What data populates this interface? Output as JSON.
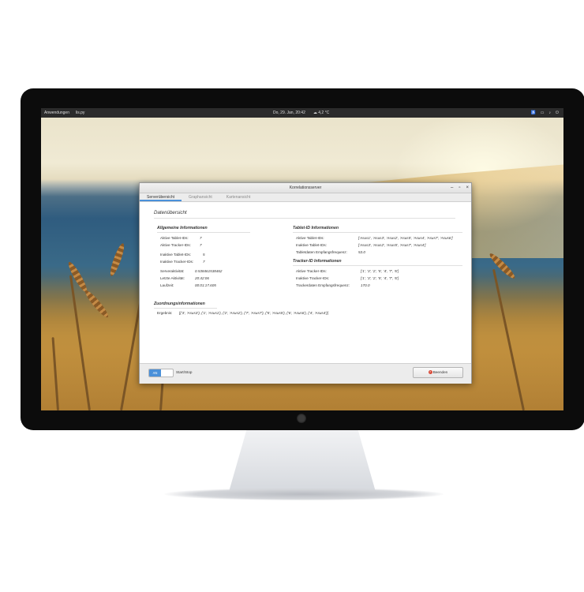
{
  "topbar": {
    "activities": "Anwendungen",
    "app": "lis.py",
    "datetime": "Do, 29. Jan, 20:42",
    "weather": "4,2 °C",
    "icons": [
      "accessibility-icon",
      "network-icon",
      "volume-icon",
      "power-icon"
    ]
  },
  "window": {
    "title": "Korrelationsserver",
    "controls": [
      "–",
      "▫",
      "×"
    ],
    "tabs": [
      {
        "label": "Serverübersicht",
        "active": true
      },
      {
        "label": "Graphansicht",
        "active": false
      },
      {
        "label": "Kartenansicht",
        "active": false
      }
    ],
    "overview_title": "Datenübersicht",
    "general": {
      "heading": "Allgemeine Informationen",
      "active_tablets_label": "Aktive Tablet-IDs:",
      "active_tablets_value": "7",
      "active_trackers_label": "Aktive Tracker-IDs:",
      "active_trackers_value": "7",
      "inactive_tablets_label": "Inaktive Tablet-IDs:",
      "inactive_tablets_value": "5",
      "inactive_trackers_label": "Inaktive Tracker-IDs:",
      "inactive_trackers_value": "7",
      "server_activity_label": "Serveraktivität:",
      "server_activity_value": "0.538461538462",
      "last_activity_label": "Letzte Aktivität:",
      "last_activity_value": "20:42:06",
      "runtime_label": "Laufzeit:",
      "runtime_value": "00:01:17.605"
    },
    "tablet": {
      "heading": "Tablet-ID Informationen",
      "active_label": "Aktive Tablet-IDs:",
      "active_value": "['Asus1', 'Asus3', 'Asus2', 'Asus5', 'Asus4', 'Asus7', 'Asus6']",
      "inactive_label": "Inaktive Tablet-IDs:",
      "inactive_value": "['Asus3', 'Asus2', 'Asus5', 'Asus7', 'Asus4']",
      "freq_label": "Tabletdaten Empfangsfrequenz:",
      "freq_value": "53.0"
    },
    "tracker": {
      "heading": "Tracker-ID Informationen",
      "active_label": "Aktive Tracker-IDs:",
      "active_value": "['1', '3', '2', '5', '4', '7', '6']",
      "inactive_label": "Inaktive Tracker-IDs:",
      "inactive_value": "['1', '3', '2', '5', '4', '7', '6']",
      "freq_label": "Trackerdaten Empfangsfrequenz:",
      "freq_value": "170.0"
    },
    "assignment": {
      "heading": "Zuordnungsinformationen",
      "result_label": "Ergebnis:",
      "result_value": "[('3', 'Asus3'), ('1', 'Asus1'), ('2', 'Asus2'), ('7', 'Asus7'), ('5', 'Asus5'), ('6', 'Asus6'), ('4', 'Asus4')]"
    },
    "bottom": {
      "toggle_on_label": "AN",
      "toggle_label": "Start/Stop",
      "quit_label": "Beenden"
    }
  }
}
